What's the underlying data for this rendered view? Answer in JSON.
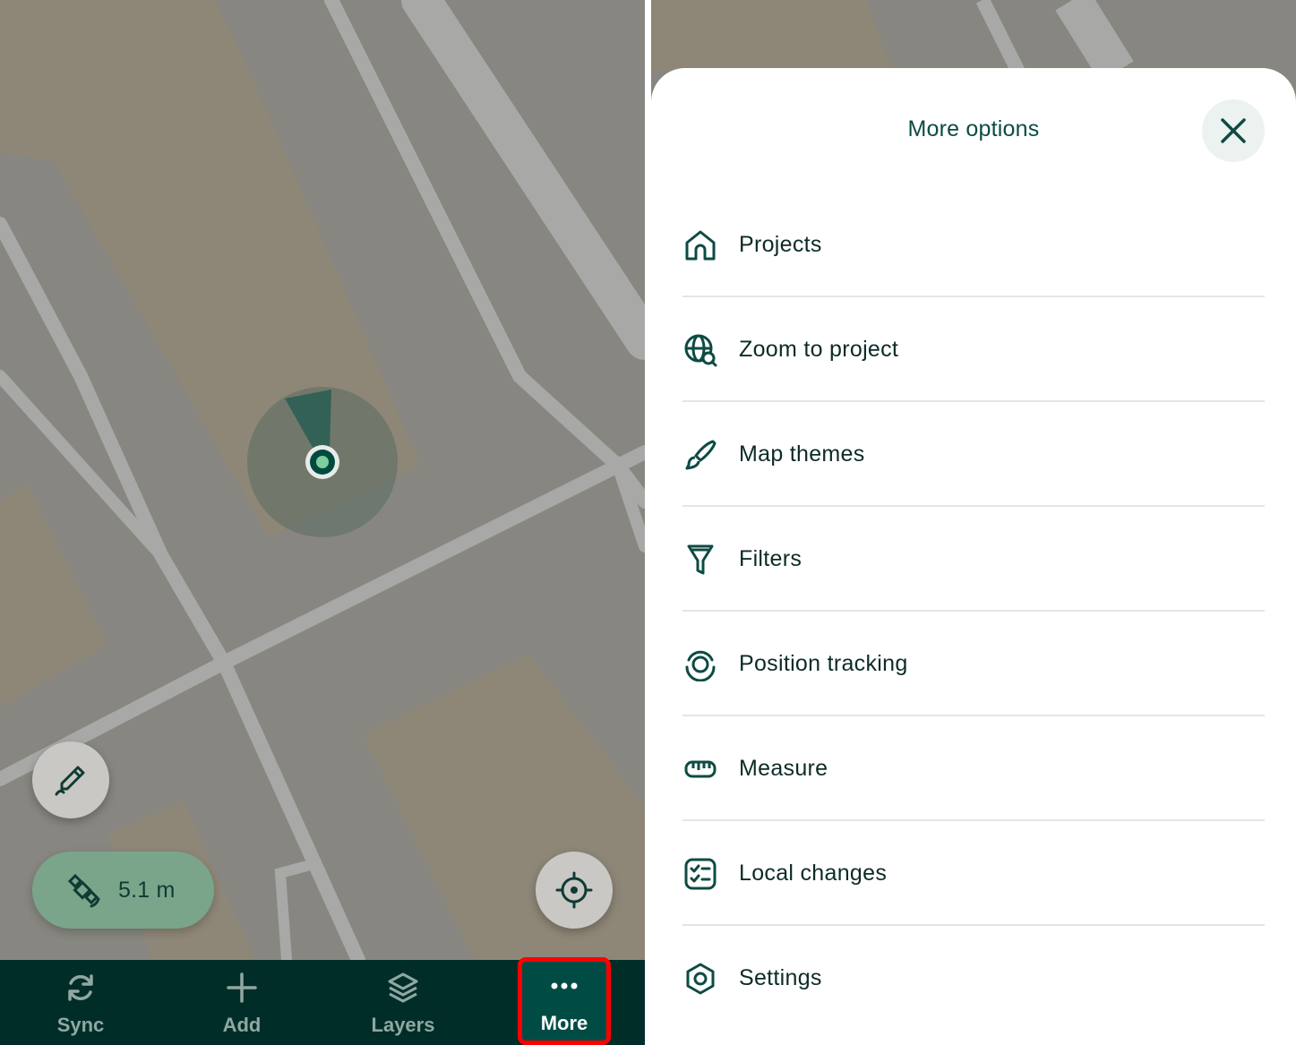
{
  "map": {
    "gps_accuracy": "5.1 m"
  },
  "bottom_nav": {
    "items": [
      {
        "label": "Sync",
        "icon": "sync-icon"
      },
      {
        "label": "Add",
        "icon": "plus-icon"
      },
      {
        "label": "Layers",
        "icon": "layers-icon"
      },
      {
        "label": "More",
        "icon": "more-dots-icon"
      }
    ]
  },
  "more_sheet": {
    "title": "More options",
    "items": [
      {
        "label": "Projects",
        "icon": "home-icon"
      },
      {
        "label": "Zoom to project",
        "icon": "globe-search-icon"
      },
      {
        "label": "Map themes",
        "icon": "brush-icon"
      },
      {
        "label": "Filters",
        "icon": "filter-icon"
      },
      {
        "label": "Position tracking",
        "icon": "position-tracking-icon"
      },
      {
        "label": "Measure",
        "icon": "ruler-icon"
      },
      {
        "label": "Local changes",
        "icon": "checklist-icon"
      },
      {
        "label": "Settings",
        "icon": "gear-icon"
      }
    ]
  },
  "colors": {
    "brand_dark": "#012d28",
    "brand_green": "#004c45",
    "accent_light": "#7aa58a",
    "highlight": "#ff0000"
  }
}
